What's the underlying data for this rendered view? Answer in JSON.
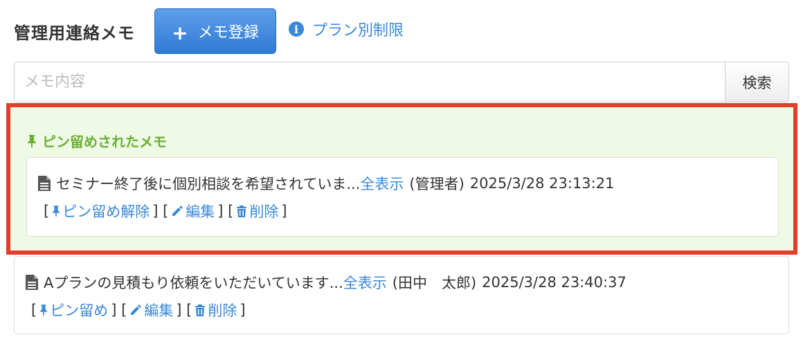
{
  "header": {
    "title": "管理用連絡メモ",
    "register_button": "メモ登録",
    "plan_limit_link": "プラン別制限"
  },
  "search": {
    "placeholder": "メモ内容",
    "button": "検索"
  },
  "pinned": {
    "heading": "ピン留めされたメモ",
    "memo": {
      "text": "セミナー終了後に個別相談を希望されていま...",
      "show_all": "全表示",
      "author": "(管理者)",
      "timestamp": "2025/3/28 23:13:21",
      "actions": {
        "unpin": "ピン留め解除",
        "edit": "編集",
        "delete": "削除"
      }
    }
  },
  "memos": [
    {
      "text": "Aプランの見積もり依頼をいただいています...",
      "show_all": "全表示",
      "author": "(田中　太郎)",
      "timestamp": "2025/3/28 23:40:37",
      "actions": {
        "pin": "ピン留め",
        "edit": "編集",
        "delete": "削除"
      }
    }
  ],
  "colors": {
    "accent_blue": "#3a88d8",
    "pinned_green": "#6ab035",
    "pinned_bg": "#eef9e6",
    "highlight_red": "#e43d2a"
  },
  "icons": [
    "plus-icon",
    "info-icon",
    "pin-icon",
    "document-icon",
    "pencil-icon",
    "trash-icon"
  ]
}
